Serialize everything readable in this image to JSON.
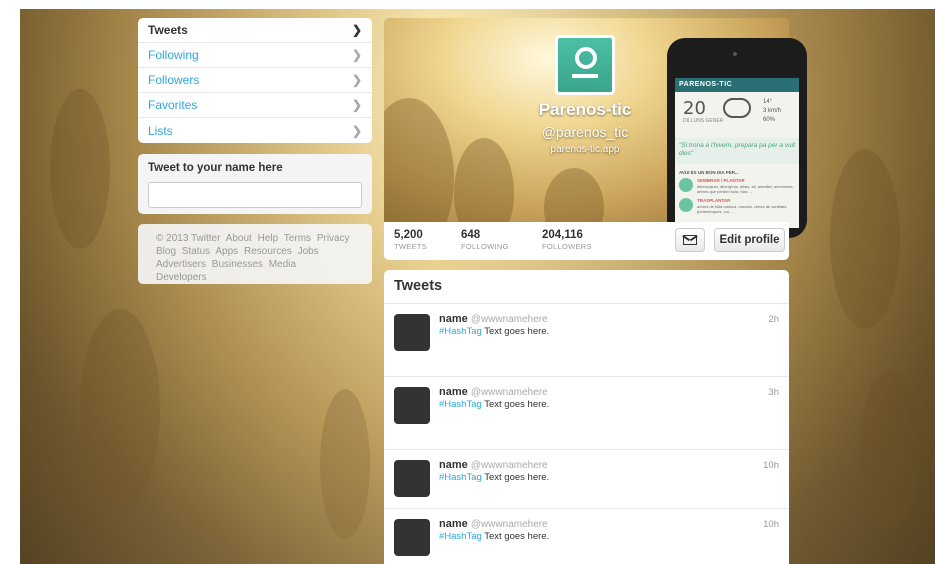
{
  "nav": {
    "items": [
      {
        "label": "Tweets"
      },
      {
        "label": "Following"
      },
      {
        "label": "Followers"
      },
      {
        "label": "Favorites"
      },
      {
        "label": "Lists"
      }
    ]
  },
  "compose": {
    "title": "Tweet to your name here",
    "value": ""
  },
  "footer": {
    "links": [
      "© 2013 Twitter",
      "About",
      "Help",
      "Terms",
      "Privacy",
      "Blog",
      "Status",
      "Apps",
      "Resources",
      "Jobs",
      "Advertisers",
      "Businesses",
      "Media",
      "Developers"
    ]
  },
  "profile": {
    "name": "Parenos-tic",
    "handle": "@parenos_tic",
    "url": "parenos-tic.app"
  },
  "phone": {
    "brand": "PARENOS-TIC",
    "day": "20",
    "day_sub": "DILLUNS GENER",
    "temps": [
      "14°",
      "3 km/h",
      "60%"
    ],
    "quote": "\"Si trona a l'hivern, prepara pa per a vuit dies\"",
    "avui": "AVUI ÉS UN BON DIA PER...",
    "tips": [
      {
        "title": "SEMBRAR / PLANTAR",
        "desc": "albercoquer, albergínia, alfals, all, ametller, anemones, arbres que perden fulla, blat, ..."
      },
      {
        "title": "TRASPLANTAR",
        "desc": "arbres de fulla caduca, carxofa, cebes de varietats primerenques, col, ..."
      }
    ]
  },
  "stats": {
    "tweets": {
      "num": "5,200",
      "label": "TWEETS"
    },
    "following": {
      "num": "648",
      "label": "FOLLOWING"
    },
    "followers": {
      "num": "204,116",
      "label": "FOLLOWERS"
    }
  },
  "actions": {
    "edit_label": "Edit profile",
    "dm_icon": "envelope-icon"
  },
  "timeline": {
    "title": "Tweets",
    "tweets": [
      {
        "name": "name",
        "handle": "@wwwnamehere",
        "hashtag": "#HashTag",
        "text": " Text goes here.",
        "time": "2h"
      },
      {
        "name": "name",
        "handle": "@wwwnamehere",
        "hashtag": "#HashTag",
        "text": " Text goes here.",
        "time": "3h"
      },
      {
        "name": "name",
        "handle": "@wwwnamehere",
        "hashtag": "#HashTag",
        "text": " Text goes here.",
        "time": "10h"
      },
      {
        "name": "name",
        "handle": "@wwwnamehere",
        "hashtag": "#HashTag",
        "text": " Text goes here.",
        "time": "10h"
      }
    ]
  },
  "colors": {
    "link": "#2fa8d7",
    "avatar_green": "#4bbfa5",
    "tweet_avatar": "#333333"
  }
}
